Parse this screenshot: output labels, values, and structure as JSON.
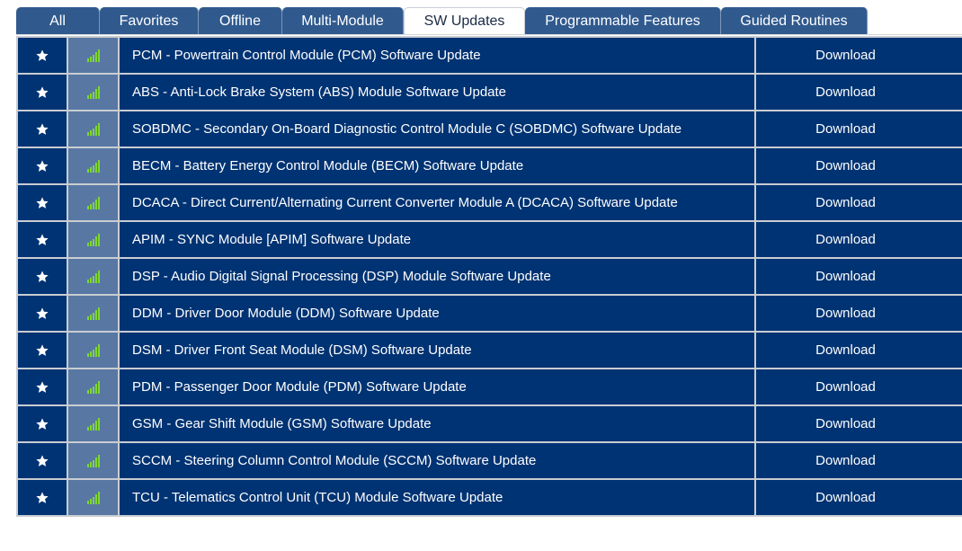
{
  "tabs": [
    {
      "label": "All",
      "active": false
    },
    {
      "label": "Favorites",
      "active": false
    },
    {
      "label": "Offline",
      "active": false
    },
    {
      "label": "Multi-Module",
      "active": false
    },
    {
      "label": "SW Updates",
      "active": true
    },
    {
      "label": "Programmable Features",
      "active": false
    },
    {
      "label": "Guided Routines",
      "active": false
    }
  ],
  "colors": {
    "row_bg": "#003373",
    "signal_cell_bg": "#5878a3",
    "signal_bars": "#7fd633",
    "tab_bg": "#305a8e"
  },
  "icons": {
    "favorite": "star-icon",
    "signal": "signal-strength-icon"
  },
  "rows": [
    {
      "name": "PCM - Powertrain Control Module (PCM) Software Update",
      "action": "Download"
    },
    {
      "name": "ABS - Anti-Lock Brake System (ABS) Module Software Update",
      "action": "Download"
    },
    {
      "name": "SOBDMC - Secondary On-Board Diagnostic Control Module C (SOBDMC) Software Update",
      "action": "Download"
    },
    {
      "name": "BECM - Battery Energy Control Module (BECM) Software Update",
      "action": "Download"
    },
    {
      "name": "DCACA - Direct Current/Alternating Current Converter Module A (DCACA) Software Update",
      "action": "Download"
    },
    {
      "name": "APIM - SYNC Module [APIM] Software Update",
      "action": "Download"
    },
    {
      "name": "DSP - Audio Digital Signal Processing (DSP) Module Software Update",
      "action": "Download"
    },
    {
      "name": "DDM - Driver Door Module (DDM) Software Update",
      "action": "Download"
    },
    {
      "name": "DSM - Driver Front Seat Module (DSM) Software Update",
      "action": "Download"
    },
    {
      "name": "PDM - Passenger Door Module (PDM) Software Update",
      "action": "Download"
    },
    {
      "name": "GSM - Gear Shift Module (GSM) Software Update",
      "action": "Download"
    },
    {
      "name": "SCCM - Steering Column Control Module (SCCM) Software Update",
      "action": "Download"
    },
    {
      "name": "TCU - Telematics Control Unit (TCU) Module Software Update",
      "action": "Download"
    }
  ]
}
